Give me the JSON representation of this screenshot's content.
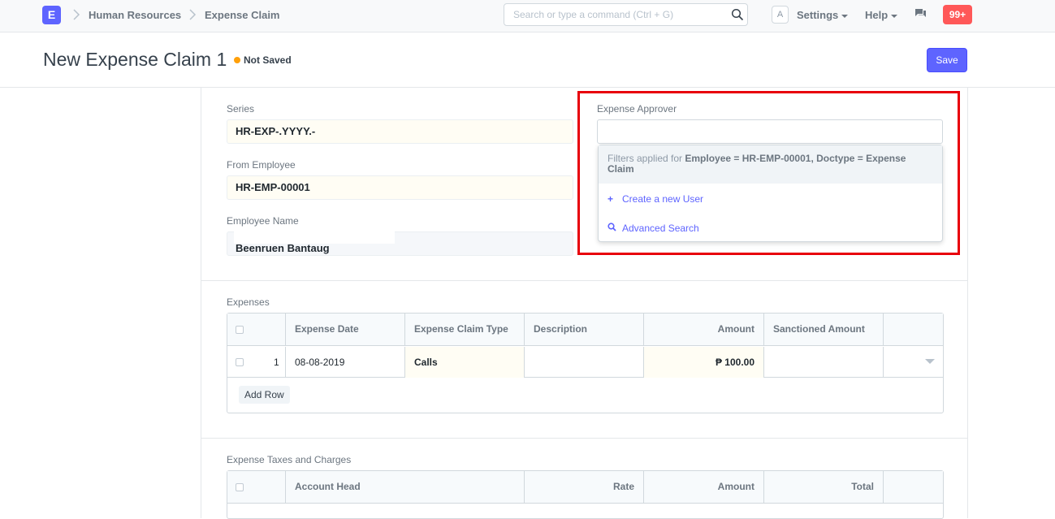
{
  "navbar": {
    "logo": "E",
    "breadcrumbs": [
      "Human Resources",
      "Expense Claim"
    ],
    "search_placeholder": "Search or type a command (Ctrl + G)",
    "avatar": "A",
    "settings": "Settings",
    "help": "Help",
    "notifications": "99+"
  },
  "page": {
    "title": "New Expense Claim 1",
    "status": "Not Saved",
    "save": "Save"
  },
  "form": {
    "series_label": "Series",
    "series_value": "HR-EXP-.YYYY.-",
    "employee_label": "From Employee",
    "employee_value": "HR-EMP-00001",
    "employee_name_label": "Employee Name",
    "employee_name_value": "Beenruen Bantaug",
    "approver_label": "Expense Approver",
    "approver_value": ""
  },
  "dropdown": {
    "filter_prefix": "Filters applied for ",
    "filter_text": "Employee = HR-EMP-00001, Doctype = Expense Claim",
    "create_user": "Create a new User",
    "advanced_search": "Advanced Search"
  },
  "expenses": {
    "section_label": "Expenses",
    "columns": [
      "Expense Date",
      "Expense Claim Type",
      "Description",
      "Amount",
      "Sanctioned Amount"
    ],
    "rows": [
      {
        "idx": "1",
        "date": "08-08-2019",
        "type": "Calls",
        "description": "",
        "amount": "₱ 100.00",
        "sanctioned": ""
      }
    ],
    "add_row": "Add Row"
  },
  "taxes": {
    "section_label": "Expense Taxes and Charges",
    "columns": [
      "Account Head",
      "Rate",
      "Amount",
      "Total"
    ]
  },
  "colors": {
    "primary": "#5e64ff",
    "highlight": "#e8000b",
    "not_saved": "#ffa00a",
    "notification": "#ff5858"
  }
}
